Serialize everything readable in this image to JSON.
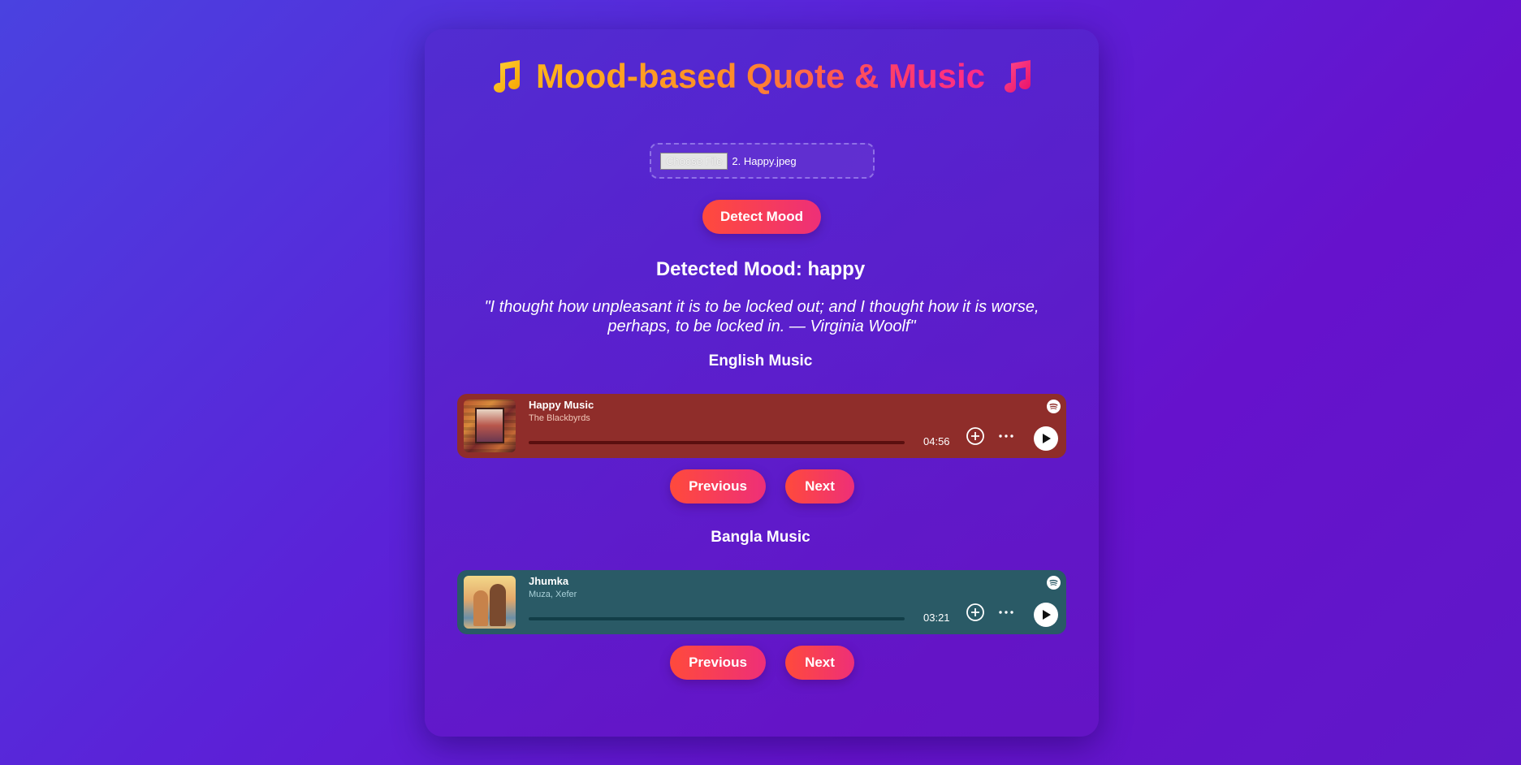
{
  "header": {
    "title": "Mood-based Quote & Music",
    "left_icon": "music-note-icon",
    "right_icon": "music-note-icon"
  },
  "upload": {
    "button_label": "Choose File",
    "file_name": "2. Happy.jpeg"
  },
  "detect_button": "Detect Mood",
  "result": {
    "mood_text": "Detected Mood: happy",
    "quote": "\"I thought how unpleasant it is to be locked out; and I thought how it is worse, perhaps, to be locked in. — Virginia Woolf\""
  },
  "english": {
    "section_title": "English Music",
    "track": {
      "title": "Happy Music",
      "artist": "The Blackbyrds",
      "duration": "04:56",
      "bg_color": "#8f2d2a"
    },
    "prev_label": "Previous",
    "next_label": "Next"
  },
  "bangla": {
    "section_title": "Bangla Music",
    "track": {
      "title": "Jhumka",
      "artist": "Muza, Xefer",
      "duration": "03:21",
      "bg_color": "#2a5a66"
    },
    "prev_label": "Previous",
    "next_label": "Next"
  },
  "colors": {
    "accent_start": "#ff4a3c",
    "accent_end": "#ee2f78",
    "title_gradient_start": "#ffb31a",
    "title_gradient_end": "#ff2a8a"
  }
}
